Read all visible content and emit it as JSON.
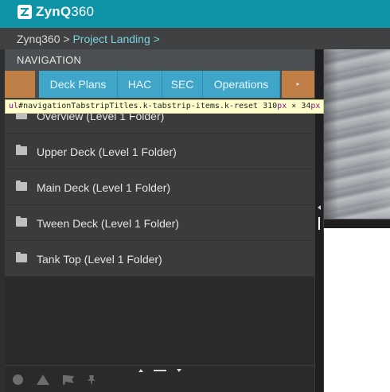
{
  "app": {
    "logo_bold": "ZynQ",
    "logo_light": "360",
    "logo_icon": "zynq-logo-icon"
  },
  "breadcrumb": {
    "root": "Zynq360",
    "separator": ">",
    "current": "Project Landing >"
  },
  "navigation": {
    "heading": "NAVIGATION",
    "tabs": [
      {
        "label": "Deck Plans"
      },
      {
        "label": "HAC"
      },
      {
        "label": "SEC"
      },
      {
        "label": "Operations"
      }
    ],
    "next_arrow": "▸"
  },
  "inspector_tooltip": {
    "selector_tag": "ul",
    "selector_rest": "#navigationTabstripTitles.k-tabstrip-items.k-reset",
    "width": "310",
    "width_unit": "px",
    "times": "×",
    "height": "34",
    "height_unit": "px"
  },
  "folders": [
    {
      "label": "Overview (Level 1 Folder)"
    },
    {
      "label": "Upper Deck (Level 1 Folder)"
    },
    {
      "label": "Main Deck (Level 1 Folder)"
    },
    {
      "label": "Tween Deck (Level 1 Folder)"
    },
    {
      "label": "Tank Top (Level 1 Folder)"
    }
  ],
  "footer_icons": [
    "info-icon",
    "warning-icon",
    "flag-icon",
    "pin-icon"
  ],
  "colors": {
    "header": "#0e94a6",
    "tab_active": "#3fa6ca",
    "tab_scroll": "#c07f46",
    "panel": "#2a2a2a",
    "folder_row": "#3b3b3b"
  }
}
